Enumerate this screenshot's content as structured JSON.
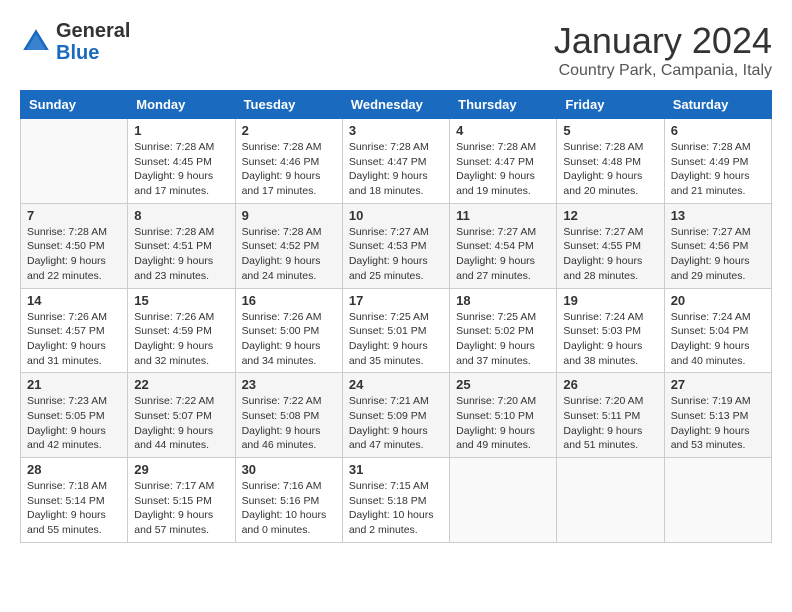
{
  "header": {
    "logo_general": "General",
    "logo_blue": "Blue",
    "title": "January 2024",
    "subtitle": "Country Park, Campania, Italy"
  },
  "days_of_week": [
    "Sunday",
    "Monday",
    "Tuesday",
    "Wednesday",
    "Thursday",
    "Friday",
    "Saturday"
  ],
  "weeks": [
    [
      {
        "day": "",
        "sunrise": "",
        "sunset": "",
        "daylight": ""
      },
      {
        "day": "1",
        "sunrise": "Sunrise: 7:28 AM",
        "sunset": "Sunset: 4:45 PM",
        "daylight": "Daylight: 9 hours and 17 minutes."
      },
      {
        "day": "2",
        "sunrise": "Sunrise: 7:28 AM",
        "sunset": "Sunset: 4:46 PM",
        "daylight": "Daylight: 9 hours and 17 minutes."
      },
      {
        "day": "3",
        "sunrise": "Sunrise: 7:28 AM",
        "sunset": "Sunset: 4:47 PM",
        "daylight": "Daylight: 9 hours and 18 minutes."
      },
      {
        "day": "4",
        "sunrise": "Sunrise: 7:28 AM",
        "sunset": "Sunset: 4:47 PM",
        "daylight": "Daylight: 9 hours and 19 minutes."
      },
      {
        "day": "5",
        "sunrise": "Sunrise: 7:28 AM",
        "sunset": "Sunset: 4:48 PM",
        "daylight": "Daylight: 9 hours and 20 minutes."
      },
      {
        "day": "6",
        "sunrise": "Sunrise: 7:28 AM",
        "sunset": "Sunset: 4:49 PM",
        "daylight": "Daylight: 9 hours and 21 minutes."
      }
    ],
    [
      {
        "day": "7",
        "sunrise": "Sunrise: 7:28 AM",
        "sunset": "Sunset: 4:50 PM",
        "daylight": "Daylight: 9 hours and 22 minutes."
      },
      {
        "day": "8",
        "sunrise": "Sunrise: 7:28 AM",
        "sunset": "Sunset: 4:51 PM",
        "daylight": "Daylight: 9 hours and 23 minutes."
      },
      {
        "day": "9",
        "sunrise": "Sunrise: 7:28 AM",
        "sunset": "Sunset: 4:52 PM",
        "daylight": "Daylight: 9 hours and 24 minutes."
      },
      {
        "day": "10",
        "sunrise": "Sunrise: 7:27 AM",
        "sunset": "Sunset: 4:53 PM",
        "daylight": "Daylight: 9 hours and 25 minutes."
      },
      {
        "day": "11",
        "sunrise": "Sunrise: 7:27 AM",
        "sunset": "Sunset: 4:54 PM",
        "daylight": "Daylight: 9 hours and 27 minutes."
      },
      {
        "day": "12",
        "sunrise": "Sunrise: 7:27 AM",
        "sunset": "Sunset: 4:55 PM",
        "daylight": "Daylight: 9 hours and 28 minutes."
      },
      {
        "day": "13",
        "sunrise": "Sunrise: 7:27 AM",
        "sunset": "Sunset: 4:56 PM",
        "daylight": "Daylight: 9 hours and 29 minutes."
      }
    ],
    [
      {
        "day": "14",
        "sunrise": "Sunrise: 7:26 AM",
        "sunset": "Sunset: 4:57 PM",
        "daylight": "Daylight: 9 hours and 31 minutes."
      },
      {
        "day": "15",
        "sunrise": "Sunrise: 7:26 AM",
        "sunset": "Sunset: 4:59 PM",
        "daylight": "Daylight: 9 hours and 32 minutes."
      },
      {
        "day": "16",
        "sunrise": "Sunrise: 7:26 AM",
        "sunset": "Sunset: 5:00 PM",
        "daylight": "Daylight: 9 hours and 34 minutes."
      },
      {
        "day": "17",
        "sunrise": "Sunrise: 7:25 AM",
        "sunset": "Sunset: 5:01 PM",
        "daylight": "Daylight: 9 hours and 35 minutes."
      },
      {
        "day": "18",
        "sunrise": "Sunrise: 7:25 AM",
        "sunset": "Sunset: 5:02 PM",
        "daylight": "Daylight: 9 hours and 37 minutes."
      },
      {
        "day": "19",
        "sunrise": "Sunrise: 7:24 AM",
        "sunset": "Sunset: 5:03 PM",
        "daylight": "Daylight: 9 hours and 38 minutes."
      },
      {
        "day": "20",
        "sunrise": "Sunrise: 7:24 AM",
        "sunset": "Sunset: 5:04 PM",
        "daylight": "Daylight: 9 hours and 40 minutes."
      }
    ],
    [
      {
        "day": "21",
        "sunrise": "Sunrise: 7:23 AM",
        "sunset": "Sunset: 5:05 PM",
        "daylight": "Daylight: 9 hours and 42 minutes."
      },
      {
        "day": "22",
        "sunrise": "Sunrise: 7:22 AM",
        "sunset": "Sunset: 5:07 PM",
        "daylight": "Daylight: 9 hours and 44 minutes."
      },
      {
        "day": "23",
        "sunrise": "Sunrise: 7:22 AM",
        "sunset": "Sunset: 5:08 PM",
        "daylight": "Daylight: 9 hours and 46 minutes."
      },
      {
        "day": "24",
        "sunrise": "Sunrise: 7:21 AM",
        "sunset": "Sunset: 5:09 PM",
        "daylight": "Daylight: 9 hours and 47 minutes."
      },
      {
        "day": "25",
        "sunrise": "Sunrise: 7:20 AM",
        "sunset": "Sunset: 5:10 PM",
        "daylight": "Daylight: 9 hours and 49 minutes."
      },
      {
        "day": "26",
        "sunrise": "Sunrise: 7:20 AM",
        "sunset": "Sunset: 5:11 PM",
        "daylight": "Daylight: 9 hours and 51 minutes."
      },
      {
        "day": "27",
        "sunrise": "Sunrise: 7:19 AM",
        "sunset": "Sunset: 5:13 PM",
        "daylight": "Daylight: 9 hours and 53 minutes."
      }
    ],
    [
      {
        "day": "28",
        "sunrise": "Sunrise: 7:18 AM",
        "sunset": "Sunset: 5:14 PM",
        "daylight": "Daylight: 9 hours and 55 minutes."
      },
      {
        "day": "29",
        "sunrise": "Sunrise: 7:17 AM",
        "sunset": "Sunset: 5:15 PM",
        "daylight": "Daylight: 9 hours and 57 minutes."
      },
      {
        "day": "30",
        "sunrise": "Sunrise: 7:16 AM",
        "sunset": "Sunset: 5:16 PM",
        "daylight": "Daylight: 10 hours and 0 minutes."
      },
      {
        "day": "31",
        "sunrise": "Sunrise: 7:15 AM",
        "sunset": "Sunset: 5:18 PM",
        "daylight": "Daylight: 10 hours and 2 minutes."
      },
      {
        "day": "",
        "sunrise": "",
        "sunset": "",
        "daylight": ""
      },
      {
        "day": "",
        "sunrise": "",
        "sunset": "",
        "daylight": ""
      },
      {
        "day": "",
        "sunrise": "",
        "sunset": "",
        "daylight": ""
      }
    ]
  ]
}
